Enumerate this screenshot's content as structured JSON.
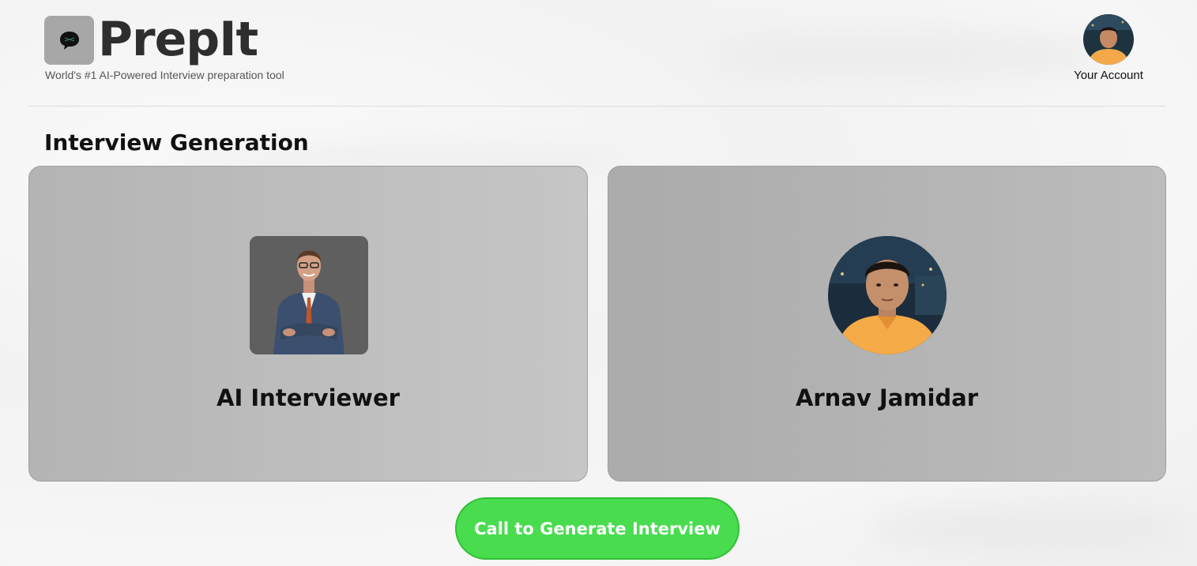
{
  "header": {
    "brand": "PrepIt",
    "tagline": "World's #1 AI-Powered Interview preparation tool",
    "logo_icon": "chat-bubble-icon",
    "account": {
      "label": "Your Account",
      "avatar_icon": "user-avatar"
    }
  },
  "main": {
    "section_title": "Interview Generation",
    "cards": [
      {
        "name": "AI Interviewer",
        "avatar_icon": "ai-interviewer-avatar"
      },
      {
        "name": "Arnav Jamidar",
        "avatar_icon": "user-avatar"
      }
    ],
    "call_button": "Call to Generate Interview"
  },
  "colors": {
    "accent": "#49dc4f",
    "card_bg": "#bdbdbd",
    "text": "#111111"
  }
}
